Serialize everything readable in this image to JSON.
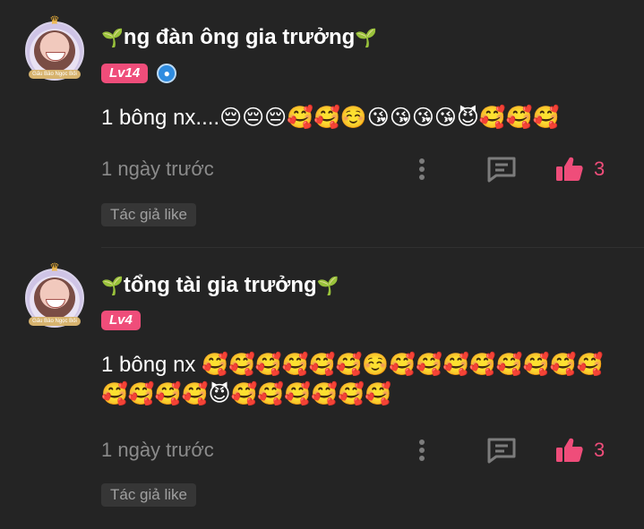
{
  "comments": [
    {
      "username": "ng đàn ông gia trưởng",
      "level": "Lv14",
      "avatar_tag": "Gấu Bảo Ngọc Bối",
      "text": "1 bông nx....😔😔😔🥰🥰☺️😘😘😘😘😈🥰🥰🥰",
      "time": "1 ngày trước",
      "like_count": "3",
      "author_like": "Tác giả like",
      "has_verify_badge": true
    },
    {
      "username": "tổng tài gia trưởng",
      "level": "Lv4",
      "avatar_tag": "Gấu Bảo Ngọc Bối",
      "text": "1 bông nx 🥰🥰🥰🥰🥰🥰☺️🥰🥰🥰🥰🥰🥰🥰🥰🥰🥰🥰🥰😈🥰🥰🥰🥰🥰🥰",
      "time": "1 ngày trước",
      "like_count": "3",
      "author_like": "Tác giả like",
      "has_verify_badge": false
    }
  ],
  "icons": {
    "sprout": "🌱",
    "crown": "♛",
    "verify": "💧"
  },
  "colors": {
    "background": "#242424",
    "level_badge": "#ef4d7a",
    "like_accent": "#ef4d7a",
    "muted_text": "#8b8b8b"
  }
}
